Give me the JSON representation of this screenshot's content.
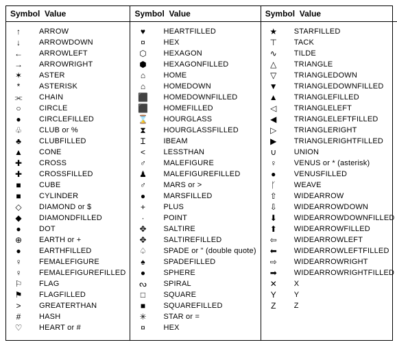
{
  "headers": {
    "symbol": "Symbol",
    "value": "Value"
  },
  "columns": [
    [
      {
        "glyph": "↑",
        "value": "ARROW"
      },
      {
        "glyph": "↓",
        "value": "ARROWDOWN"
      },
      {
        "glyph": "←",
        "value": "ARROWLEFT"
      },
      {
        "glyph": "→",
        "value": "ARROWRIGHT"
      },
      {
        "glyph": "✶",
        "value": "ASTER"
      },
      {
        "glyph": "*",
        "value": "ASTERISK"
      },
      {
        "glyph": "⫘",
        "value": "CHAIN"
      },
      {
        "glyph": "○",
        "value": "CIRCLE"
      },
      {
        "glyph": "●",
        "value": "CIRCLEFILLED"
      },
      {
        "glyph": "♧",
        "value": "CLUB or %"
      },
      {
        "glyph": "♣",
        "value": "CLUBFILLED"
      },
      {
        "glyph": "▲",
        "value": "CONE"
      },
      {
        "glyph": "✚",
        "value": "CROSS"
      },
      {
        "glyph": "✚",
        "value": "CROSSFILLED"
      },
      {
        "glyph": "■",
        "value": "CUBE"
      },
      {
        "glyph": "■",
        "value": "CYLINDER"
      },
      {
        "glyph": "◇",
        "value": "DIAMOND or $"
      },
      {
        "glyph": "◆",
        "value": "DIAMONDFILLED"
      },
      {
        "glyph": "●",
        "value": "DOT"
      },
      {
        "glyph": "⊕",
        "value": "EARTH or +"
      },
      {
        "glyph": "●",
        "value": "EARTHFILLED"
      },
      {
        "glyph": "♀",
        "value": "FEMALEFIGURE"
      },
      {
        "glyph": "♀",
        "value": "FEMALEFIGUREFILLED"
      },
      {
        "glyph": "⚐",
        "value": "FLAG"
      },
      {
        "glyph": "⚑",
        "value": "FLAGFILLED"
      },
      {
        "glyph": ">",
        "value": "GREATERTHAN"
      },
      {
        "glyph": "#",
        "value": "HASH"
      },
      {
        "glyph": "♡",
        "value": "HEART or #"
      }
    ],
    [
      {
        "glyph": "♥",
        "value": "HEARTFILLED"
      },
      {
        "glyph": "¤",
        "value": "HEX"
      },
      {
        "glyph": "⬡",
        "value": "HEXAGON"
      },
      {
        "glyph": "⬢",
        "value": "HEXAGONFILLED"
      },
      {
        "glyph": "⌂",
        "value": "HOME"
      },
      {
        "glyph": "⌂",
        "value": "HOMEDOWN"
      },
      {
        "glyph": "⬛",
        "value": "HOMEDOWNFILLED"
      },
      {
        "glyph": "⬛",
        "value": "HOMEFILLED"
      },
      {
        "glyph": "⌛",
        "value": "HOURGLASS"
      },
      {
        "glyph": "⧗",
        "value": "HOURGLASSFILLED"
      },
      {
        "glyph": "Ɪ",
        "value": "IBEAM"
      },
      {
        "glyph": "<",
        "value": "LESSTHAN"
      },
      {
        "glyph": "♂",
        "value": "MALEFIGURE"
      },
      {
        "glyph": "♟",
        "value": "MALEFIGUREFILLED"
      },
      {
        "glyph": "♂",
        "value": "MARS or >"
      },
      {
        "glyph": "●",
        "value": "MARSFILLED"
      },
      {
        "glyph": "+",
        "value": "PLUS"
      },
      {
        "glyph": "·",
        "value": "POINT"
      },
      {
        "glyph": "✥",
        "value": "SALTIRE"
      },
      {
        "glyph": "✥",
        "value": "SALTIREFILLED"
      },
      {
        "glyph": "♤",
        "value": "SPADE or \" (double quote)"
      },
      {
        "glyph": "♠",
        "value": "SPADEFILLED"
      },
      {
        "glyph": "●",
        "value": "SPHERE"
      },
      {
        "glyph": "ᔓ",
        "value": "SPIRAL"
      },
      {
        "glyph": "□",
        "value": "SQUARE"
      },
      {
        "glyph": "■",
        "value": "SQUAREFILLED"
      },
      {
        "glyph": "✳",
        "value": "STAR or ="
      },
      {
        "glyph": "¤",
        "value": "HEX"
      }
    ],
    [
      {
        "glyph": "★",
        "value": "STARFILLED"
      },
      {
        "glyph": "⊤",
        "value": "TACK"
      },
      {
        "glyph": "∿",
        "value": "TILDE"
      },
      {
        "glyph": "△",
        "value": "TRIANGLE"
      },
      {
        "glyph": "▽",
        "value": "TRIANGLEDOWN"
      },
      {
        "glyph": "▼",
        "value": "TRIANGLEDOWNFILLED"
      },
      {
        "glyph": "▲",
        "value": "TRIANGLEFILLED"
      },
      {
        "glyph": "◁",
        "value": "TRIANGLELEFT"
      },
      {
        "glyph": "◀",
        "value": "TRIANGLELEFTFILLED"
      },
      {
        "glyph": "▷",
        "value": "TRIANGLERIGHT"
      },
      {
        "glyph": "▶",
        "value": "TRIANGLERIGHTFILLED"
      },
      {
        "glyph": "∪",
        "value": "UNION"
      },
      {
        "glyph": "♀",
        "value": "VENUS or * (asterisk)"
      },
      {
        "glyph": "●",
        "value": "VENUSFILLED"
      },
      {
        "glyph": "ᚴ",
        "value": "WEAVE"
      },
      {
        "glyph": "⇧",
        "value": "WIDEARROW"
      },
      {
        "glyph": "⇩",
        "value": "WIDEARROWDOWN"
      },
      {
        "glyph": "⬇",
        "value": "WIDEARROWDOWNFILLED"
      },
      {
        "glyph": "⬆",
        "value": "WIDEARROWFILLED"
      },
      {
        "glyph": "⇦",
        "value": "WIDEARROWLEFT"
      },
      {
        "glyph": "⬅",
        "value": "WIDEARROWLEFTFILLED"
      },
      {
        "glyph": "⇨",
        "value": "WIDEARROWRIGHT"
      },
      {
        "glyph": "➡",
        "value": "WIDEARROWRIGHTFILLED"
      },
      {
        "glyph": "✕",
        "value": "X"
      },
      {
        "glyph": "Y",
        "value": "Y"
      },
      {
        "glyph": "Ζ",
        "value": "Z"
      }
    ]
  ]
}
